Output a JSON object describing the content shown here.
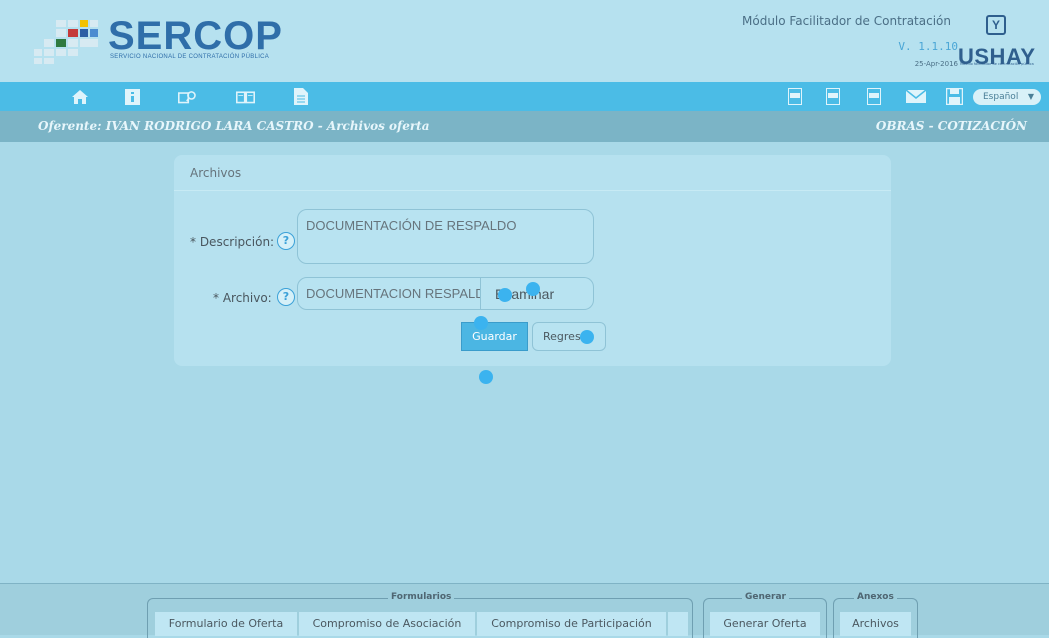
{
  "header": {
    "logo_text": "SERCOP",
    "logo_subtitle": "SERVICIO NACIONAL DE CONTRATACIÓN PÚBLICA",
    "module_title": "Módulo Facilitador de Contratación",
    "version": "V. 1.1.10",
    "date": "25-Apr-2016",
    "ushay_logo": "USHAY",
    "ushay_subtitle": "Módulo facilitador de contratación pública"
  },
  "toolbar": {
    "left_icons": [
      "home-icon",
      "info-icon",
      "search-document-icon",
      "book-icon",
      "document-icon"
    ],
    "right_icons": [
      "pdf-icon",
      "pdf-icon",
      "pdf-icon",
      "mail-icon",
      "save-icon"
    ],
    "language": "Español"
  },
  "subheader": {
    "oferente": "Oferente: IVAN RODRIGO LARA CASTRO - Archivos oferta",
    "tipo": "OBRAS - COTIZACIÓN"
  },
  "form": {
    "title": "Archivos",
    "descripcion_label": "* Descripción:",
    "descripcion_value": "DOCUMENTACIÓN DE RESPALDO",
    "archivo_label": "* Archivo:",
    "archivo_value": "DOCUMENTACION RESPALDO",
    "browse_label": "Examinar",
    "save_label": "Guardar",
    "back_label": "Regresar",
    "help_glyph": "?"
  },
  "footer": {
    "groups": [
      {
        "legend": "Formularios",
        "tabs": [
          "Formulario de Oferta",
          "Compromiso de Asociación",
          "Compromiso de Participación"
        ]
      },
      {
        "legend": "Generar",
        "tabs": [
          "Generar Oferta"
        ]
      },
      {
        "legend": "Anexos",
        "tabs": [
          "Archivos"
        ]
      }
    ]
  },
  "colors": {
    "background": "#a9d9e8",
    "toolbar": "#4bbce6",
    "subheader": "#7bb4c6",
    "accent": "#3bb3ef"
  }
}
